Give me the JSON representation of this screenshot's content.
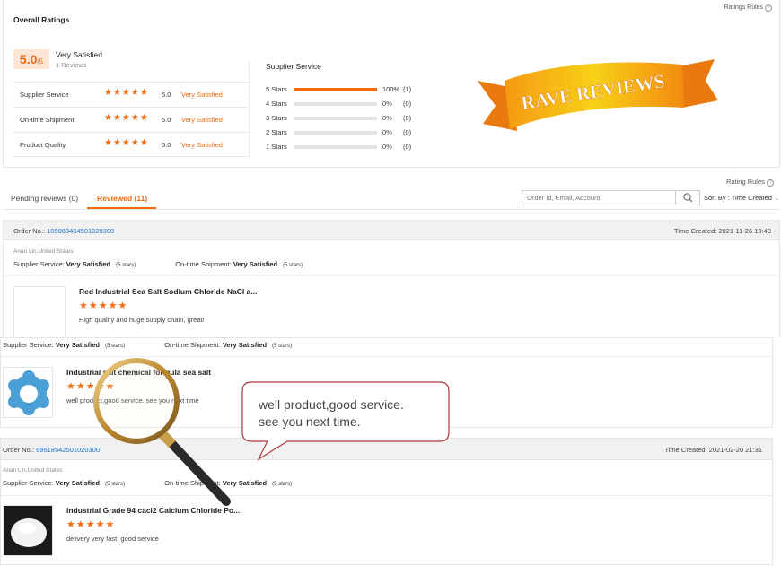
{
  "overall": {
    "title": "Overall Ratings",
    "rules_link": "Ratings Rules",
    "score": "5.0",
    "score_suffix": "/5",
    "label": "Very Satisfied",
    "reviews_count": "1 Reviews",
    "categories": [
      {
        "name": "Supplier Service",
        "stars": "★★★★★",
        "score": "5.0",
        "label": "Very Satisfied"
      },
      {
        "name": "On-time Shipment",
        "stars": "★★★★★",
        "score": "5.0",
        "label": "Very Satisfied"
      },
      {
        "name": "Product Quality",
        "stars": "★★★★★",
        "score": "5.0",
        "label": "Very Satisfied"
      }
    ]
  },
  "supplier_service": {
    "title": "Supplier Service",
    "rows": [
      {
        "label": "5 Stars",
        "fill": 1.0,
        "percent": "100%",
        "count": "(1)"
      },
      {
        "label": "4 Stars",
        "fill": 0,
        "percent": "0%",
        "count": "(0)"
      },
      {
        "label": "3 Stars",
        "fill": 0,
        "percent": "0%",
        "count": "(0)"
      },
      {
        "label": "2 Stars",
        "fill": 0,
        "percent": "0%",
        "count": "(0)"
      },
      {
        "label": "1 Stars",
        "fill": 0,
        "percent": "0%",
        "count": "(0)"
      }
    ]
  },
  "banner": {
    "text": "RAVE REVIEWS",
    "colors": {
      "ribbon": "#f7d117",
      "ribbon_shadow": "#e37b0d",
      "text": "#ffffff"
    }
  },
  "reviews_header": {
    "rules_link": "Rating Rules",
    "tabs": [
      {
        "label": "Pending reviews (0)"
      },
      {
        "label": "Reviewed (11)"
      }
    ],
    "search_placeholder": "Order Id, Email, Account",
    "sort": "Sort By : Time Created"
  },
  "orders": [
    {
      "order_label": "Order No.:",
      "order_no": "105063434501020300",
      "time": "Time Created: 2021-11-26 19:49",
      "buyer": "Anan Lin,United States",
      "supplier_service_label": "Supplier Service:",
      "supplier_service_value": "Very Satisfied",
      "supplier_service_stars": "(5 stars)",
      "shipment_label": "On-time Shipment:",
      "shipment_value": "Very Satisfied",
      "shipment_stars": "(5 stars)",
      "product": "Red Industrial Sea Salt Sodium Chloride NaCl a...",
      "stars": "★★★★★",
      "comment": "High quality and huge supply chain, great!"
    },
    {
      "supplier_service_label": "Supplier Service:",
      "supplier_service_value": "Very Satisfied",
      "supplier_service_stars": "(5 stars)",
      "shipment_label": "On-time Shipment:",
      "shipment_value": "Very Satisfied",
      "shipment_stars": "(5 stars)",
      "product": "Industrial salt chemical formula sea salt",
      "stars": "★★★★★",
      "comment": "well product,good service. see you next time"
    },
    {
      "order_label": "Order No.:",
      "order_no": "69618542501020300",
      "time": "Time Created: 2021-02-20 21:31",
      "buyer": "Anan Lin,United States",
      "supplier_service_label": "Supplier Service:",
      "supplier_service_value": "Very Satisfied",
      "supplier_service_stars": "(5 stars)",
      "shipment_label": "On-time Shipment:",
      "shipment_value": "Very Satisfied",
      "shipment_stars": "(5 stars)",
      "product": "Industrial Grade 94 cacl2 Calcium Chloride Po...",
      "stars": "★★★★★",
      "comment": "delivery very fast, good service"
    }
  ],
  "callout": {
    "line1": "well product,good service.",
    "line2": "see you next time."
  }
}
